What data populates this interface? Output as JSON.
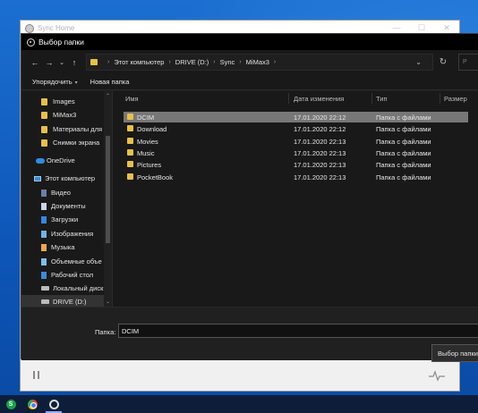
{
  "app": {
    "title": "Sync Home",
    "controls": {
      "minimize": "—",
      "maximize": "☐",
      "close": "✕"
    }
  },
  "dialog": {
    "title": "Выбор папки",
    "nav": {
      "back": "←",
      "forward": "→",
      "history": "⌄",
      "up": "↑"
    },
    "breadcrumb": [
      "Этот компьютер",
      "DRIVE (D:)",
      "Sync",
      "MiMax3"
    ],
    "address_dropdown": "⌄",
    "refresh": "↻",
    "search_placeholder": "Р",
    "toolbar": {
      "organize": "Упорядочить",
      "organize_arrow": "▾",
      "new_folder": "Новая папка"
    },
    "sidebar": [
      {
        "label": "Images",
        "icon": "folder-icon"
      },
      {
        "label": "MiMax3",
        "icon": "folder-icon"
      },
      {
        "label": "Материалы для",
        "icon": "folder-icon"
      },
      {
        "label": "Снимки экрана",
        "icon": "folder-icon"
      },
      {
        "label": "OneDrive",
        "icon": "onedrive-icon"
      },
      {
        "label": "Этот компьютер",
        "icon": "computer-icon"
      },
      {
        "label": "Видео",
        "icon": "video-library-icon"
      },
      {
        "label": "Документы",
        "icon": "documents-library-icon"
      },
      {
        "label": "Загрузки",
        "icon": "downloads-library-icon"
      },
      {
        "label": "Изображения",
        "icon": "pictures-library-icon"
      },
      {
        "label": "Музыка",
        "icon": "music-library-icon"
      },
      {
        "label": "Объемные объе",
        "icon": "3d-objects-icon"
      },
      {
        "label": "Рабочий стол",
        "icon": "desktop-library-icon"
      },
      {
        "label": "Локальный диск",
        "icon": "local-disk-icon"
      },
      {
        "label": "DRIVE (D:)",
        "icon": "drive-icon",
        "selected": true
      }
    ],
    "columns": {
      "name": "Имя",
      "modified": "Дата изменения",
      "type": "Тип",
      "size": "Размер"
    },
    "files": [
      {
        "name": "DCIM",
        "modified": "17.01.2020 22:12",
        "type": "Папка с файлами",
        "selected": true
      },
      {
        "name": "Download",
        "modified": "17.01.2020 22:12",
        "type": "Папка с файлами"
      },
      {
        "name": "Movies",
        "modified": "17.01.2020 22:13",
        "type": "Папка с файлами"
      },
      {
        "name": "Music",
        "modified": "17.01.2020 22:13",
        "type": "Папка с файлами"
      },
      {
        "name": "Pictures",
        "modified": "17.01.2020 22:13",
        "type": "Папка с файлами"
      },
      {
        "name": "PocketBook",
        "modified": "17.01.2020 22:13",
        "type": "Папка с файлами"
      }
    ],
    "folder_label": "Папка:",
    "folder_value": "DCIM",
    "select_button": "Выбор папки"
  },
  "colors": {
    "desktop": "#1565c8",
    "dialog_bg": "#202020",
    "folder": "#e8c048",
    "selection": "#777777",
    "taskbar": "#0e1e3a"
  }
}
